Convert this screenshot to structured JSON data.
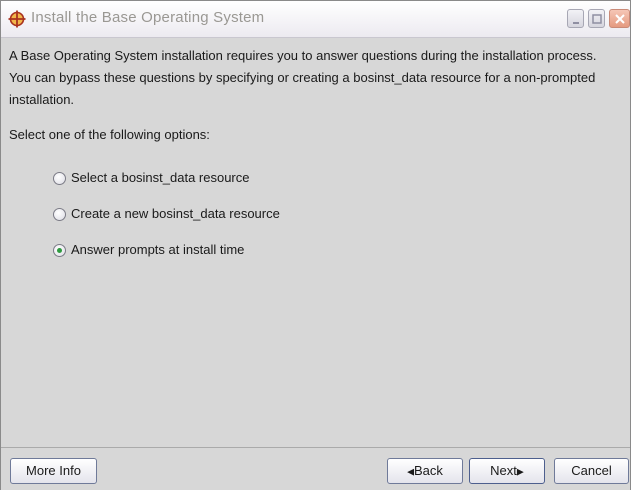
{
  "window": {
    "title": "Install the Base Operating System",
    "icon": "crosshair-globe-icon",
    "controls": [
      "minimize-icon",
      "maximize-icon",
      "close-icon"
    ]
  },
  "content": {
    "description": "A Base Operating System installation requires you to answer questions during the installation process.  You can bypass these questions by specifying or creating a bosinst_data resource for a non-prompted installation.",
    "prompt": "Select one of the following options:",
    "options": [
      {
        "label": "Select a bosinst_data resource",
        "selected": false
      },
      {
        "label": "Create a new bosinst_data resource",
        "selected": false
      },
      {
        "label": "Answer prompts at install time",
        "selected": true
      }
    ]
  },
  "footer": {
    "more_info": "More Info",
    "back": "Back",
    "next": "Next",
    "cancel": "Cancel"
  },
  "colors": {
    "window_bg": "#d7d7d7",
    "selected_dot": "#2e9a3f",
    "close_button": "#e59a80"
  }
}
